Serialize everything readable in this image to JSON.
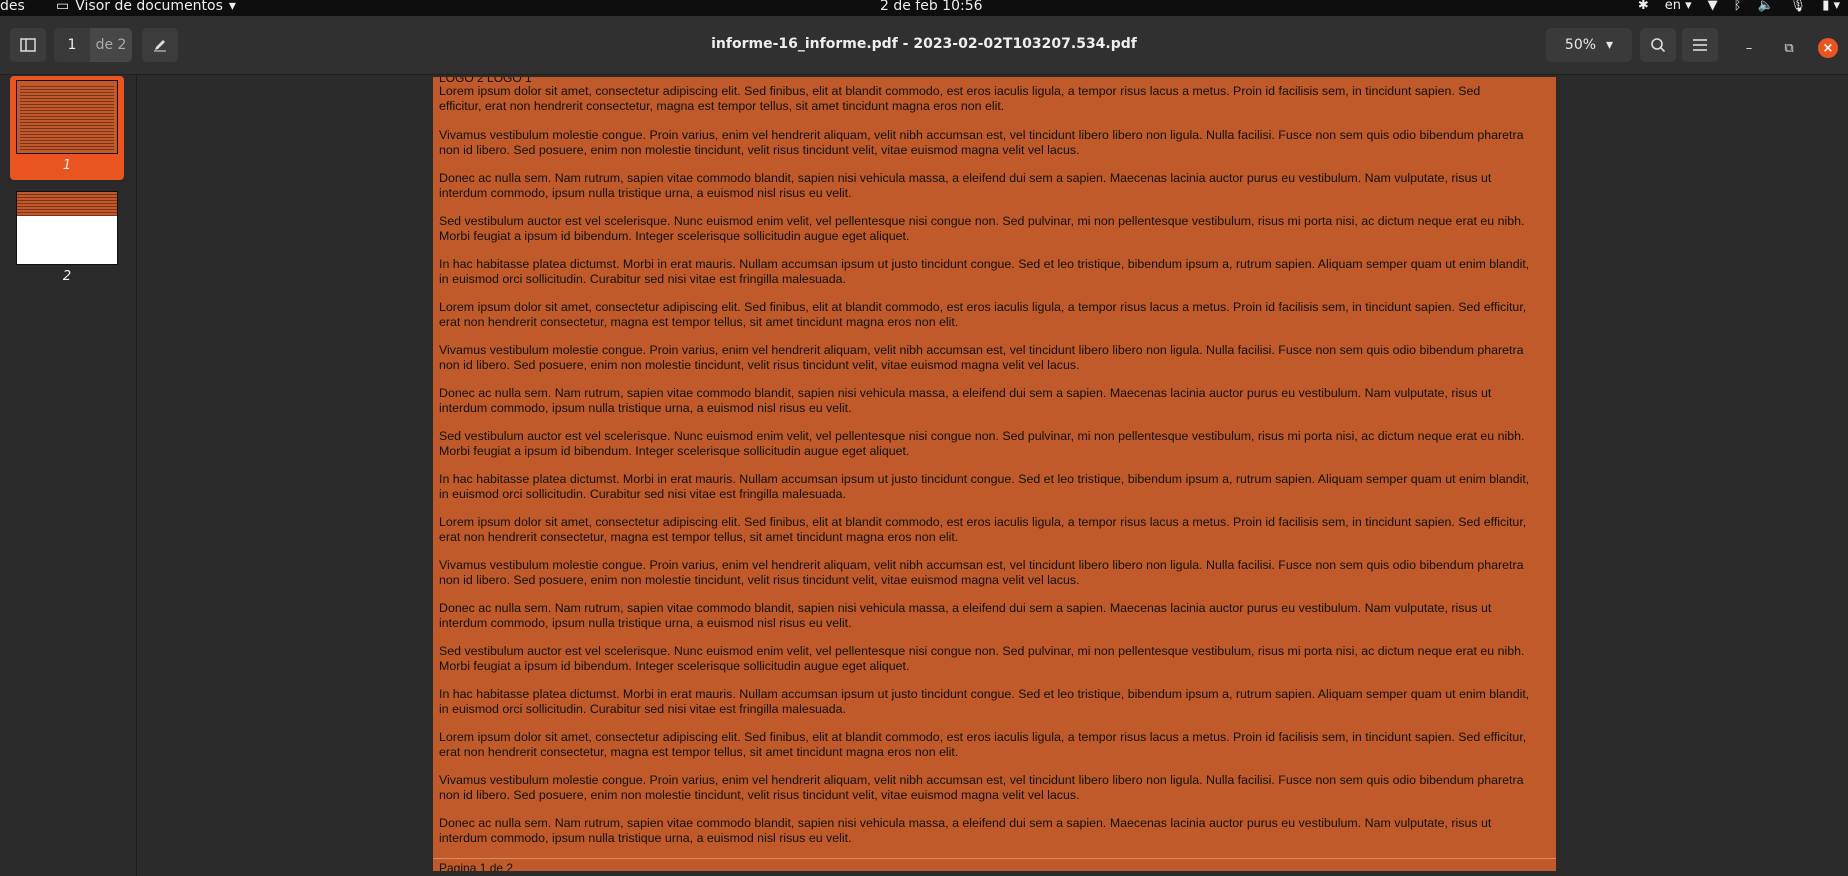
{
  "topbar": {
    "activities": "des",
    "app_name": "Visor de documentos",
    "clock": "2 de feb  10:56",
    "lang": "en"
  },
  "toolbar": {
    "page_current": "1",
    "page_of": "de 2",
    "title": "informe-16_informe.pdf - 2023-02-02T103207.534.pdf",
    "zoom": "50%"
  },
  "sidebar": {
    "pages": [
      {
        "label": "1",
        "selected": true
      },
      {
        "label": "2",
        "selected": false
      }
    ]
  },
  "document": {
    "header": "LOGO 2 LOGO 1",
    "first_fragment": "Lorem ipsum dolor sit amet, consectetur adipiscing elit. Sed finibus, elit at blandit commodo, est eros iaculis ligula, a tempor risus lacus a metus. Proin id facilisis sem, in tincidunt sapien. Sed",
    "paragraphs": [
      "efficitur, erat non hendrerit consectetur, magna est tempor tellus, sit amet tincidunt magna eros non elit.",
      "Vivamus vestibulum molestie congue. Proin varius, enim vel hendrerit aliquam, velit nibh accumsan est, vel tincidunt libero libero non ligula. Nulla facilisi. Fusce non sem quis odio bibendum pharetra non id libero. Sed posuere, enim non molestie tincidunt, velit risus tincidunt velit, vitae euismod magna velit vel lacus.",
      "Donec ac nulla sem. Nam rutrum, sapien vitae commodo blandit, sapien nisi vehicula massa, a eleifend dui sem a sapien. Maecenas lacinia auctor purus eu vestibulum. Nam vulputate, risus ut interdum commodo, ipsum nulla tristique urna, a euismod nisl risus eu velit.",
      "Sed vestibulum auctor est vel scelerisque. Nunc euismod enim velit, vel pellentesque nisi congue non. Sed pulvinar, mi non pellentesque vestibulum, risus mi porta nisi, ac dictum neque erat eu nibh. Morbi feugiat a ipsum id bibendum. Integer scelerisque sollicitudin augue eget aliquet.",
      "In hac habitasse platea dictumst. Morbi in erat mauris. Nullam accumsan ipsum ut justo tincidunt congue. Sed et leo tristique, bibendum ipsum a, rutrum sapien. Aliquam semper quam ut enim blandit, in euismod orci sollicitudin. Curabitur sed nisi vitae est fringilla malesuada.",
      "Lorem ipsum dolor sit amet, consectetur adipiscing elit. Sed finibus, elit at blandit commodo, est eros iaculis ligula, a tempor risus lacus a metus. Proin id facilisis sem, in tincidunt sapien. Sed efficitur, erat non hendrerit consectetur, magna est tempor tellus, sit amet tincidunt magna eros non elit.",
      "Vivamus vestibulum molestie congue. Proin varius, enim vel hendrerit aliquam, velit nibh accumsan est, vel tincidunt libero libero non ligula. Nulla facilisi. Fusce non sem quis odio bibendum pharetra non id libero. Sed posuere, enim non molestie tincidunt, velit risus tincidunt velit, vitae euismod magna velit vel lacus.",
      "Donec ac nulla sem. Nam rutrum, sapien vitae commodo blandit, sapien nisi vehicula massa, a eleifend dui sem a sapien. Maecenas lacinia auctor purus eu vestibulum. Nam vulputate, risus ut interdum commodo, ipsum nulla tristique urna, a euismod nisl risus eu velit.",
      "Sed vestibulum auctor est vel scelerisque. Nunc euismod enim velit, vel pellentesque nisi congue non. Sed pulvinar, mi non pellentesque vestibulum, risus mi porta nisi, ac dictum neque erat eu nibh. Morbi feugiat a ipsum id bibendum. Integer scelerisque sollicitudin augue eget aliquet.",
      "In hac habitasse platea dictumst. Morbi in erat mauris. Nullam accumsan ipsum ut justo tincidunt congue. Sed et leo tristique, bibendum ipsum a, rutrum sapien. Aliquam semper quam ut enim blandit, in euismod orci sollicitudin. Curabitur sed nisi vitae est fringilla malesuada.",
      "Lorem ipsum dolor sit amet, consectetur adipiscing elit. Sed finibus, elit at blandit commodo, est eros iaculis ligula, a tempor risus lacus a metus. Proin id facilisis sem, in tincidunt sapien. Sed efficitur, erat non hendrerit consectetur, magna est tempor tellus, sit amet tincidunt magna eros non elit.",
      "Vivamus vestibulum molestie congue. Proin varius, enim vel hendrerit aliquam, velit nibh accumsan est, vel tincidunt libero libero non ligula. Nulla facilisi. Fusce non sem quis odio bibendum pharetra non id libero. Sed posuere, enim non molestie tincidunt, velit risus tincidunt velit, vitae euismod magna velit vel lacus.",
      "Donec ac nulla sem. Nam rutrum, sapien vitae commodo blandit, sapien nisi vehicula massa, a eleifend dui sem a sapien. Maecenas lacinia auctor purus eu vestibulum. Nam vulputate, risus ut interdum commodo, ipsum nulla tristique urna, a euismod nisl risus eu velit.",
      "Sed vestibulum auctor est vel scelerisque. Nunc euismod enim velit, vel pellentesque nisi congue non. Sed pulvinar, mi non pellentesque vestibulum, risus mi porta nisi, ac dictum neque erat eu nibh. Morbi feugiat a ipsum id bibendum. Integer scelerisque sollicitudin augue eget aliquet.",
      "In hac habitasse platea dictumst. Morbi in erat mauris. Nullam accumsan ipsum ut justo tincidunt congue. Sed et leo tristique, bibendum ipsum a, rutrum sapien. Aliquam semper quam ut enim blandit, in euismod orci sollicitudin. Curabitur sed nisi vitae est fringilla malesuada.",
      "Lorem ipsum dolor sit amet, consectetur adipiscing elit. Sed finibus, elit at blandit commodo, est eros iaculis ligula, a tempor risus lacus a metus. Proin id facilisis sem, in tincidunt sapien. Sed efficitur, erat non hendrerit consectetur, magna est tempor tellus, sit amet tincidunt magna eros non elit.",
      "Vivamus vestibulum molestie congue. Proin varius, enim vel hendrerit aliquam, velit nibh accumsan est, vel tincidunt libero libero non ligula. Nulla facilisi. Fusce non sem quis odio bibendum pharetra non id libero. Sed posuere, enim non molestie tincidunt, velit risus tincidunt velit, vitae euismod magna velit vel lacus.",
      "Donec ac nulla sem. Nam rutrum, sapien vitae commodo blandit, sapien nisi vehicula massa, a eleifend dui sem a sapien. Maecenas lacinia auctor purus eu vestibulum. Nam vulputate, risus ut interdum commodo, ipsum nulla tristique urna, a euismod nisl risus eu velit."
    ],
    "footer": "Pagina 1 de 2"
  },
  "colors": {
    "accent": "#e95420",
    "page_bg": "#c05a2b"
  },
  "icons": [
    "sidebar-toggle-icon",
    "annotate-pencil-icon",
    "search-icon",
    "menu-icon",
    "minimize-icon",
    "maximize-icon",
    "close-icon",
    "wifi-icon",
    "bluetooth-icon",
    "volume-icon",
    "mic-icon",
    "battery-icon",
    "slack-icon"
  ]
}
